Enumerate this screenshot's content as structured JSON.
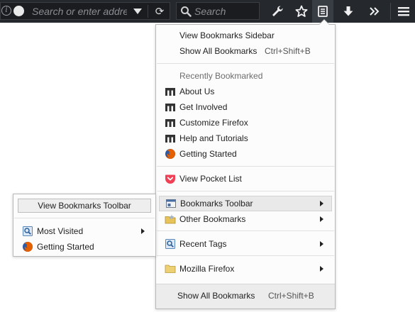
{
  "toolbar": {
    "url_placeholder": "Search or enter address",
    "search_placeholder": "Search",
    "colors": {
      "background": "#25282d",
      "field": "#1a1c20"
    },
    "icons": [
      "info-icon",
      "identity-icon",
      "dropmarker-icon",
      "reload-icon",
      "search-icon",
      "wrench-icon",
      "star-icon",
      "bookmarks-menu-icon",
      "download-icon",
      "overflow-icon",
      "hamburger-menu-icon"
    ]
  },
  "bookmarks_menu": {
    "view_sidebar": "View Bookmarks Sidebar",
    "show_all": {
      "label": "Show All Bookmarks",
      "shortcut": "Ctrl+Shift+B"
    },
    "recent_header": "Recently Bookmarked",
    "recent_items": [
      {
        "label": "About Us",
        "icon": "mozilla-m-icon"
      },
      {
        "label": "Get Involved",
        "icon": "mozilla-m-icon"
      },
      {
        "label": "Customize Firefox",
        "icon": "mozilla-m-icon"
      },
      {
        "label": "Help and Tutorials",
        "icon": "mozilla-m-icon"
      },
      {
        "label": "Getting Started",
        "icon": "firefox-icon"
      }
    ],
    "pocket": {
      "label": "View Pocket List",
      "icon": "pocket-icon"
    },
    "bookmarks_toolbar": {
      "label": "Bookmarks Toolbar",
      "icon": "toolbar-folder-icon"
    },
    "other_bookmarks": {
      "label": "Other Bookmarks",
      "icon": "other-bookmarks-folder-icon"
    },
    "recent_tags": {
      "label": "Recent Tags",
      "icon": "recent-tags-icon"
    },
    "mozilla_firefox": {
      "label": "Mozilla Firefox",
      "icon": "folder-icon"
    },
    "footer": {
      "label": "Show All Bookmarks",
      "shortcut": "Ctrl+Shift+B"
    }
  },
  "toolbar_submenu": {
    "view_toolbar_button": "View Bookmarks Toolbar",
    "items": [
      {
        "label": "Most Visited",
        "icon": "most-visited-icon"
      },
      {
        "label": "Getting Started",
        "icon": "firefox-icon"
      }
    ]
  }
}
